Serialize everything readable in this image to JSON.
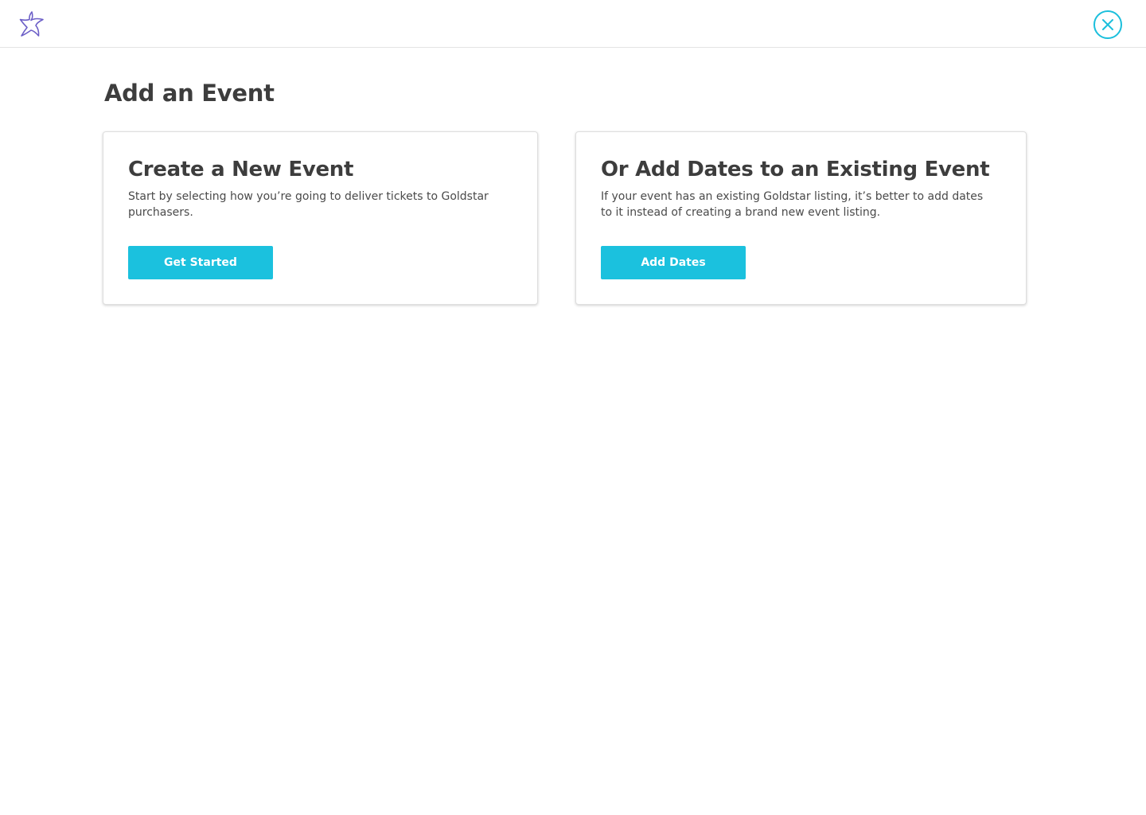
{
  "colors": {
    "accent": "#1bc1de",
    "logo": "#6c5fc7",
    "title": "#3d3d3d"
  },
  "header": {
    "logo_icon": "goldstar-star-logo-icon",
    "close_icon": "close-icon"
  },
  "page": {
    "title": "Add an Event"
  },
  "cards": [
    {
      "title": "Create a New Event",
      "description": "Start by selecting how you’re going to deliver tickets to Goldstar purchasers.",
      "button_label": "Get Started"
    },
    {
      "title": "Or Add Dates to an Existing Event",
      "description": "If your event has an existing Goldstar listing, it’s better to add dates to it instead of creating a brand new event listing.",
      "button_label": "Add Dates"
    }
  ]
}
